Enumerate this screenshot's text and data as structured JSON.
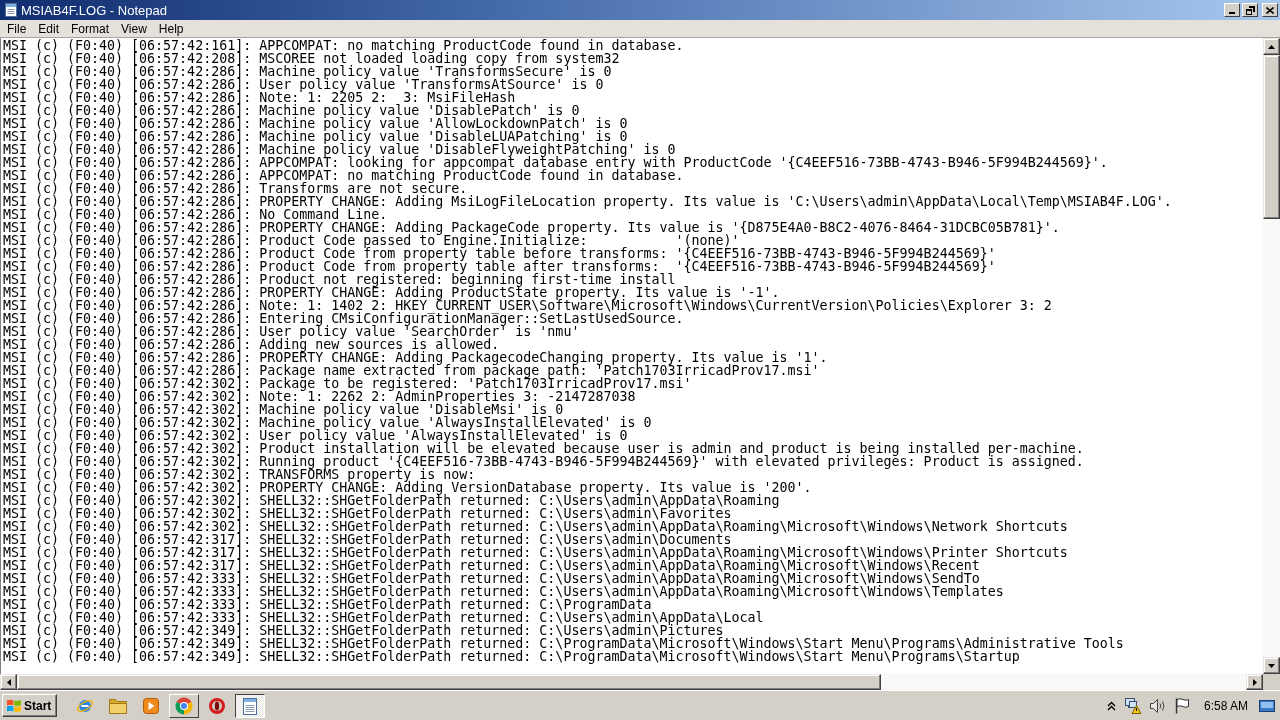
{
  "window": {
    "title": "MSIAB4F.LOG - Notepad",
    "maximized": true
  },
  "menu": [
    "File",
    "Edit",
    "Format",
    "View",
    "Help"
  ],
  "editor": {
    "lines": [
      "MSI (c) (F0:40) [06:57:42:161]: APPCOMPAT: no matching ProductCode found in database.",
      "MSI (c) (F0:40) [06:57:42:208]: MSCOREE not loaded loading copy from system32",
      "MSI (c) (F0:40) [06:57:42:286]: Machine policy value 'TransformsSecure' is 0",
      "MSI (c) (F0:40) [06:57:42:286]: User policy value 'TransformsAtSource' is 0",
      "MSI (c) (F0:40) [06:57:42:286]: Note: 1: 2205 2:  3: MsiFileHash",
      "MSI (c) (F0:40) [06:57:42:286]: Machine policy value 'DisablePatch' is 0",
      "MSI (c) (F0:40) [06:57:42:286]: Machine policy value 'AllowLockdownPatch' is 0",
      "MSI (c) (F0:40) [06:57:42:286]: Machine policy value 'DisableLUAPatching' is 0",
      "MSI (c) (F0:40) [06:57:42:286]: Machine policy value 'DisableFlyweightPatching' is 0",
      "MSI (c) (F0:40) [06:57:42:286]: APPCOMPAT: looking for appcompat database entry with ProductCode '{C4EEF516-73BB-4743-B946-5F994B244569}'.",
      "MSI (c) (F0:40) [06:57:42:286]: APPCOMPAT: no matching ProductCode found in database.",
      "MSI (c) (F0:40) [06:57:42:286]: Transforms are not secure.",
      "MSI (c) (F0:40) [06:57:42:286]: PROPERTY CHANGE: Adding MsiLogFileLocation property. Its value is 'C:\\Users\\admin\\AppData\\Local\\Temp\\MSIAB4F.LOG'.",
      "MSI (c) (F0:40) [06:57:42:286]: No Command Line.",
      "MSI (c) (F0:40) [06:57:42:286]: PROPERTY CHANGE: Adding PackageCode property. Its value is '{D875E4A0-B8C2-4076-8464-31DCBC05B781}'.",
      "MSI (c) (F0:40) [06:57:42:286]: Product Code passed to Engine.Initialize:           '(none)'",
      "MSI (c) (F0:40) [06:57:42:286]: Product Code from property table before transforms: '{C4EEF516-73BB-4743-B946-5F994B244569}'",
      "MSI (c) (F0:40) [06:57:42:286]: Product Code from property table after transforms:  '{C4EEF516-73BB-4743-B946-5F994B244569}'",
      "MSI (c) (F0:40) [06:57:42:286]: Product not registered: beginning first-time install",
      "MSI (c) (F0:40) [06:57:42:286]: PROPERTY CHANGE: Adding ProductState property. Its value is '-1'.",
      "MSI (c) (F0:40) [06:57:42:286]: Note: 1: 1402 2: HKEY_CURRENT_USER\\Software\\Microsoft\\Windows\\CurrentVersion\\Policies\\Explorer 3: 2",
      "MSI (c) (F0:40) [06:57:42:286]: Entering CMsiConfigurationManager::SetLastUsedSource.",
      "MSI (c) (F0:40) [06:57:42:286]: User policy value 'SearchOrder' is 'nmu'",
      "MSI (c) (F0:40) [06:57:42:286]: Adding new sources is allowed.",
      "MSI (c) (F0:40) [06:57:42:286]: PROPERTY CHANGE: Adding PackagecodeChanging property. Its value is '1'.",
      "MSI (c) (F0:40) [06:57:42:286]: Package name extracted from package path: 'Patch1703IrricadProv17.msi'",
      "MSI (c) (F0:40) [06:57:42:302]: Package to be registered: 'Patch1703IrricadProv17.msi'",
      "MSI (c) (F0:40) [06:57:42:302]: Note: 1: 2262 2: AdminProperties 3: -2147287038",
      "MSI (c) (F0:40) [06:57:42:302]: Machine policy value 'DisableMsi' is 0",
      "MSI (c) (F0:40) [06:57:42:302]: Machine policy value 'AlwaysInstallElevated' is 0",
      "MSI (c) (F0:40) [06:57:42:302]: User policy value 'AlwaysInstallElevated' is 0",
      "MSI (c) (F0:40) [06:57:42:302]: Product installation will be elevated because user is admin and product is being installed per-machine.",
      "MSI (c) (F0:40) [06:57:42:302]: Running product '{C4EEF516-73BB-4743-B946-5F994B244569}' with elevated privileges: Product is assigned.",
      "MSI (c) (F0:40) [06:57:42:302]: TRANSFORMS property is now:",
      "MSI (c) (F0:40) [06:57:42:302]: PROPERTY CHANGE: Adding VersionDatabase property. Its value is '200'.",
      "MSI (c) (F0:40) [06:57:42:302]: SHELL32::SHGetFolderPath returned: C:\\Users\\admin\\AppData\\Roaming",
      "MSI (c) (F0:40) [06:57:42:302]: SHELL32::SHGetFolderPath returned: C:\\Users\\admin\\Favorites",
      "MSI (c) (F0:40) [06:57:42:302]: SHELL32::SHGetFolderPath returned: C:\\Users\\admin\\AppData\\Roaming\\Microsoft\\Windows\\Network Shortcuts",
      "MSI (c) (F0:40) [06:57:42:317]: SHELL32::SHGetFolderPath returned: C:\\Users\\admin\\Documents",
      "MSI (c) (F0:40) [06:57:42:317]: SHELL32::SHGetFolderPath returned: C:\\Users\\admin\\AppData\\Roaming\\Microsoft\\Windows\\Printer Shortcuts",
      "MSI (c) (F0:40) [06:57:42:317]: SHELL32::SHGetFolderPath returned: C:\\Users\\admin\\AppData\\Roaming\\Microsoft\\Windows\\Recent",
      "MSI (c) (F0:40) [06:57:42:333]: SHELL32::SHGetFolderPath returned: C:\\Users\\admin\\AppData\\Roaming\\Microsoft\\Windows\\SendTo",
      "MSI (c) (F0:40) [06:57:42:333]: SHELL32::SHGetFolderPath returned: C:\\Users\\admin\\AppData\\Roaming\\Microsoft\\Windows\\Templates",
      "MSI (c) (F0:40) [06:57:42:333]: SHELL32::SHGetFolderPath returned: C:\\ProgramData",
      "MSI (c) (F0:40) [06:57:42:333]: SHELL32::SHGetFolderPath returned: C:\\Users\\admin\\AppData\\Local",
      "MSI (c) (F0:40) [06:57:42:349]: SHELL32::SHGetFolderPath returned: C:\\Users\\admin\\Pictures",
      "MSI (c) (F0:40) [06:57:42:349]: SHELL32::SHGetFolderPath returned: C:\\ProgramData\\Microsoft\\Windows\\Start Menu\\Programs\\Administrative Tools",
      "MSI (c) (F0:40) [06:57:42:349]: SHELL32::SHGetFolderPath returned: C:\\ProgramData\\Microsoft\\Windows\\Start Menu\\Programs\\Startup"
    ]
  },
  "taskbar": {
    "start": "Start",
    "apps": [
      {
        "kind": "globe",
        "open": false,
        "selected": false
      },
      {
        "kind": "folder",
        "open": false,
        "selected": false
      },
      {
        "kind": "player",
        "open": false,
        "selected": false
      },
      {
        "kind": "segments",
        "open": true,
        "selected": false
      },
      {
        "kind": "ring",
        "open": false,
        "selected": false
      },
      {
        "kind": "notepad",
        "open": true,
        "selected": true
      }
    ],
    "clock": "6:58 AM"
  }
}
